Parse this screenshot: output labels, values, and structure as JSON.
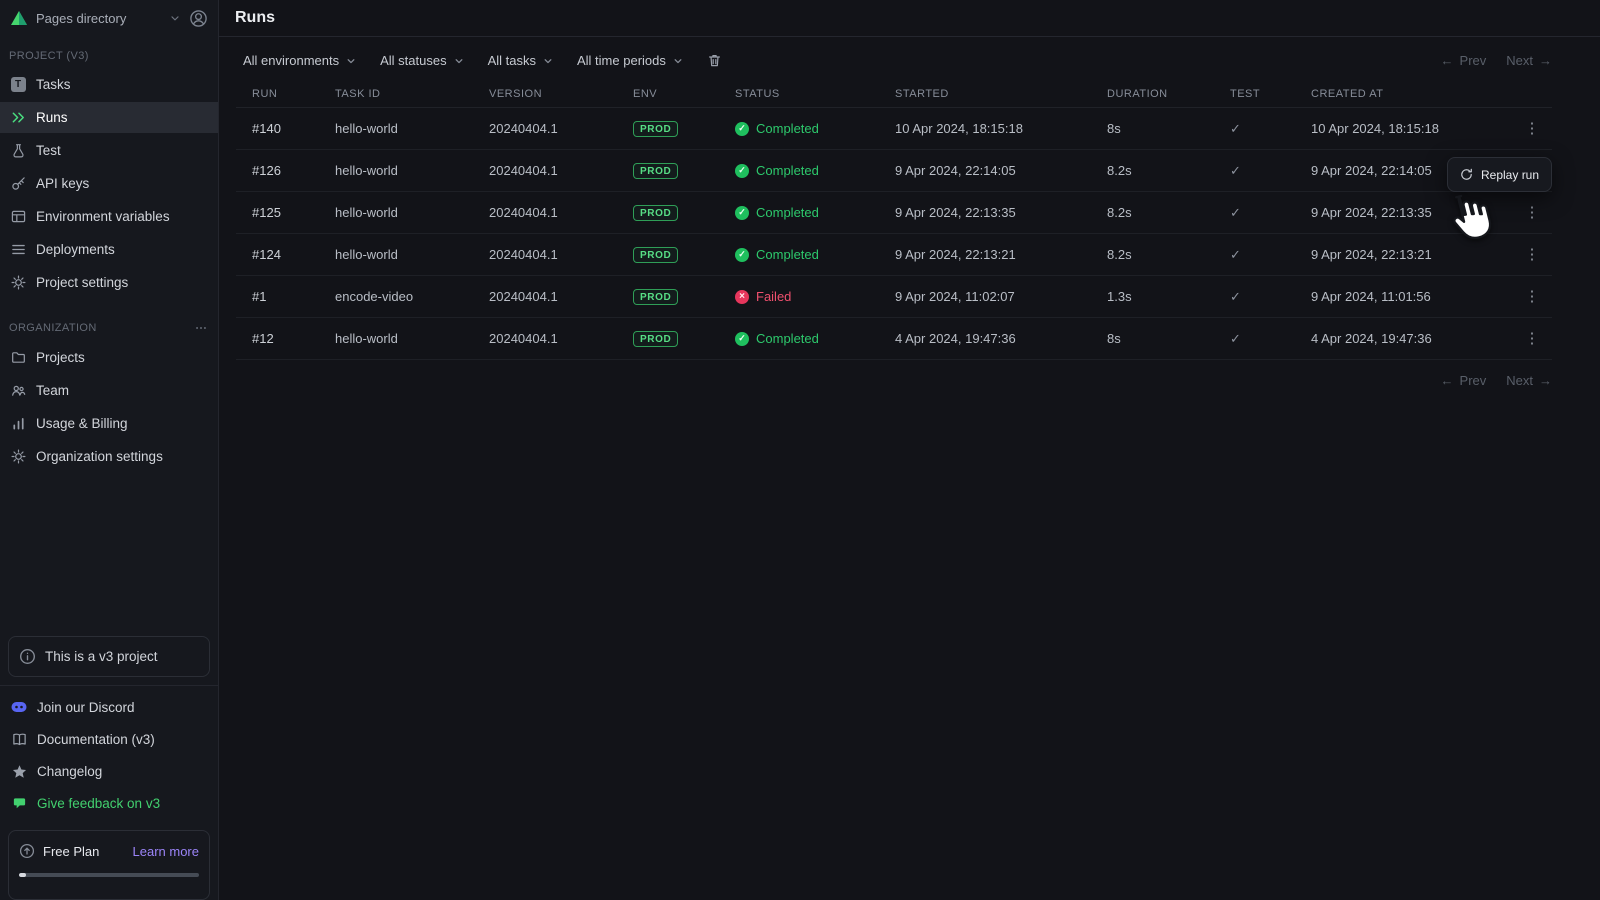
{
  "icons": {
    "kebab": "⋮",
    "check": "✓",
    "cross": "×",
    "arrow_left": "←",
    "arrow_right": "→",
    "task_letter": "T"
  },
  "colors": {
    "accent_green": "#41d97c",
    "failed_red": "#ef4467",
    "link_purple": "#9b84f8",
    "discord_blue": "#5865f2",
    "prod_green": "#57dd85"
  },
  "sidebar": {
    "workspace": "Pages directory",
    "sections": [
      {
        "label": "PROJECT (V3)",
        "items": [
          "Tasks",
          "Runs",
          "Test",
          "API keys",
          "Environment variables",
          "Deployments",
          "Project settings"
        ]
      },
      {
        "label": "ORGANIZATION",
        "items": [
          "Projects",
          "Team",
          "Usage & Billing",
          "Organization settings"
        ]
      }
    ],
    "notice": "This is a v3 project",
    "links": [
      "Join our Discord",
      "Documentation (v3)",
      "Changelog",
      "Give feedback on v3"
    ],
    "plan": {
      "name": "Free Plan",
      "action": "Learn more"
    }
  },
  "main": {
    "title": "Runs",
    "filters": [
      "All environments",
      "All statuses",
      "All tasks",
      "All time periods"
    ],
    "pagination": {
      "prev": "Prev",
      "next": "Next"
    },
    "context_menu": {
      "replay": "Replay run"
    }
  },
  "table": {
    "columns": [
      "Run",
      "Task ID",
      "Version",
      "Env",
      "Status",
      "Started",
      "Duration",
      "Test",
      "Created at"
    ],
    "rows": [
      {
        "run": "#140",
        "task_id": "hello-world",
        "version": "20240404.1",
        "env": "PROD",
        "status": "Completed",
        "status_type": "success",
        "started": "10 Apr 2024, 18:15:18",
        "duration": "8s",
        "test": "✓",
        "created_at": "10 Apr 2024, 18:15:18"
      },
      {
        "run": "#126",
        "task_id": "hello-world",
        "version": "20240404.1",
        "env": "PROD",
        "status": "Completed",
        "status_type": "success",
        "started": "9 Apr 2024, 22:14:05",
        "duration": "8.2s",
        "test": "✓",
        "created_at": "9 Apr 2024, 22:14:05"
      },
      {
        "run": "#125",
        "task_id": "hello-world",
        "version": "20240404.1",
        "env": "PROD",
        "status": "Completed",
        "status_type": "success",
        "started": "9 Apr 2024, 22:13:35",
        "duration": "8.2s",
        "test": "✓",
        "created_at": "9 Apr 2024, 22:13:35"
      },
      {
        "run": "#124",
        "task_id": "hello-world",
        "version": "20240404.1",
        "env": "PROD",
        "status": "Completed",
        "status_type": "success",
        "started": "9 Apr 2024, 22:13:21",
        "duration": "8.2s",
        "test": "✓",
        "created_at": "9 Apr 2024, 22:13:21"
      },
      {
        "run": "#1",
        "task_id": "encode-video",
        "version": "20240404.1",
        "env": "PROD",
        "status": "Failed",
        "status_type": "failed",
        "started": "9 Apr 2024, 11:02:07",
        "duration": "1.3s",
        "test": "✓",
        "created_at": "9 Apr 2024, 11:01:56"
      },
      {
        "run": "#12",
        "task_id": "hello-world",
        "version": "20240404.1",
        "env": "PROD",
        "status": "Completed",
        "status_type": "success",
        "started": "4 Apr 2024, 19:47:36",
        "duration": "8s",
        "test": "✓",
        "created_at": "4 Apr 2024, 19:47:36"
      }
    ]
  }
}
